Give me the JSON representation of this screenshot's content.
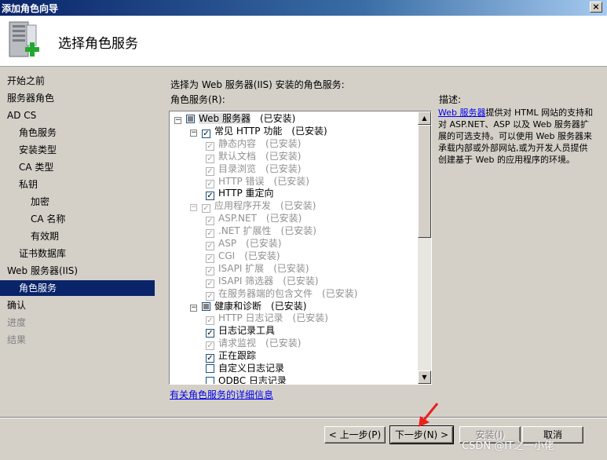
{
  "window": {
    "title": "添加角色向导",
    "close_label": "×"
  },
  "header": {
    "title": "选择角色服务"
  },
  "nav": {
    "items": [
      {
        "label": "开始之前",
        "indent": 0,
        "state": "normal"
      },
      {
        "label": "服务器角色",
        "indent": 0,
        "state": "normal"
      },
      {
        "label": "AD CS",
        "indent": 0,
        "state": "normal"
      },
      {
        "label": "角色服务",
        "indent": 1,
        "state": "normal"
      },
      {
        "label": "安装类型",
        "indent": 1,
        "state": "normal"
      },
      {
        "label": "CA 类型",
        "indent": 1,
        "state": "normal"
      },
      {
        "label": "私钥",
        "indent": 1,
        "state": "normal"
      },
      {
        "label": "加密",
        "indent": 2,
        "state": "normal"
      },
      {
        "label": "CA 名称",
        "indent": 2,
        "state": "normal"
      },
      {
        "label": "有效期",
        "indent": 2,
        "state": "normal"
      },
      {
        "label": "证书数据库",
        "indent": 1,
        "state": "normal"
      },
      {
        "label": "Web 服务器(IIS)",
        "indent": 0,
        "state": "normal"
      },
      {
        "label": "角色服务",
        "indent": 1,
        "state": "selected"
      },
      {
        "label": "确认",
        "indent": 0,
        "state": "normal"
      },
      {
        "label": "进度",
        "indent": 0,
        "state": "dim"
      },
      {
        "label": "结果",
        "indent": 0,
        "state": "dim"
      }
    ]
  },
  "main": {
    "instruction": "选择为 Web 服务器(IIS) 安装的角色服务:",
    "list_label": "角色服务(R):",
    "tree": [
      {
        "label": "Web 服务器",
        "status": "(已安装)",
        "level": 0,
        "expander": "⊟",
        "check": "partial",
        "disabled": false,
        "highlight": true
      },
      {
        "label": "常见 HTTP 功能",
        "status": "(已安装)",
        "level": 1,
        "expander": "⊟",
        "check": "checked",
        "disabled": false
      },
      {
        "label": "静态内容",
        "status": "(已安装)",
        "level": 2,
        "check": "checked",
        "disabled": true
      },
      {
        "label": "默认文档",
        "status": "(已安装)",
        "level": 2,
        "check": "checked",
        "disabled": true
      },
      {
        "label": "目录浏览",
        "status": "(已安装)",
        "level": 2,
        "check": "checked",
        "disabled": true
      },
      {
        "label": "HTTP 错误",
        "status": "(已安装)",
        "level": 2,
        "check": "checked",
        "disabled": true
      },
      {
        "label": "HTTP 重定向",
        "status": "",
        "level": 2,
        "check": "checked",
        "disabled": false
      },
      {
        "label": "应用程序开发",
        "status": "(已安装)",
        "level": 1,
        "expander": "⊟",
        "check": "checked",
        "disabled": true
      },
      {
        "label": "ASP.NET",
        "status": "(已安装)",
        "level": 2,
        "check": "checked",
        "disabled": true
      },
      {
        "label": ".NET 扩展性",
        "status": "(已安装)",
        "level": 2,
        "check": "checked",
        "disabled": true
      },
      {
        "label": "ASP",
        "status": "(已安装)",
        "level": 2,
        "check": "checked",
        "disabled": true
      },
      {
        "label": "CGI",
        "status": "(已安装)",
        "level": 2,
        "check": "checked",
        "disabled": true
      },
      {
        "label": "ISAPI 扩展",
        "status": "(已安装)",
        "level": 2,
        "check": "checked",
        "disabled": true
      },
      {
        "label": "ISAPI 筛选器",
        "status": "(已安装)",
        "level": 2,
        "check": "checked",
        "disabled": true
      },
      {
        "label": "在服务器端的包含文件",
        "status": "(已安装)",
        "level": 2,
        "check": "checked",
        "disabled": true
      },
      {
        "label": "健康和诊断",
        "status": "(已安装)",
        "level": 1,
        "expander": "⊟",
        "check": "partial",
        "disabled": false
      },
      {
        "label": "HTTP 日志记录",
        "status": "(已安装)",
        "level": 2,
        "check": "checked",
        "disabled": true
      },
      {
        "label": "日志记录工具",
        "status": "",
        "level": 2,
        "check": "checked",
        "disabled": false
      },
      {
        "label": "请求监视",
        "status": "(已安装)",
        "level": 2,
        "check": "checked",
        "disabled": true
      },
      {
        "label": "正在跟踪",
        "status": "",
        "level": 2,
        "check": "checked",
        "disabled": false
      },
      {
        "label": "自定义日志记录",
        "status": "",
        "level": 2,
        "check": "unchecked",
        "disabled": false
      },
      {
        "label": "ODBC 日志记录",
        "status": "",
        "level": 2,
        "check": "unchecked",
        "disabled": false
      }
    ],
    "more_info_link": "有关角色服务的详细信息",
    "description_heading": "描述:",
    "description_link": "Web 服务器",
    "description_body": "提供对 HTML 网站的支持和对 ASP.NET、ASP 以及 Web 服务器扩展的可选支持。可以使用 Web 服务器来承载内部或外部网站,或为开发人员提供创建基于 Web 的应用程序的环境。"
  },
  "buttons": {
    "prev": "< 上一步(P)",
    "next": "下一步(N) >",
    "install": "安装(I)",
    "cancel": "取消"
  },
  "watermark": "CSDN @IT之一小佬",
  "colors": {
    "selection": "#0a246a",
    "link": "#0000ee",
    "arrow": "#e8221a"
  }
}
